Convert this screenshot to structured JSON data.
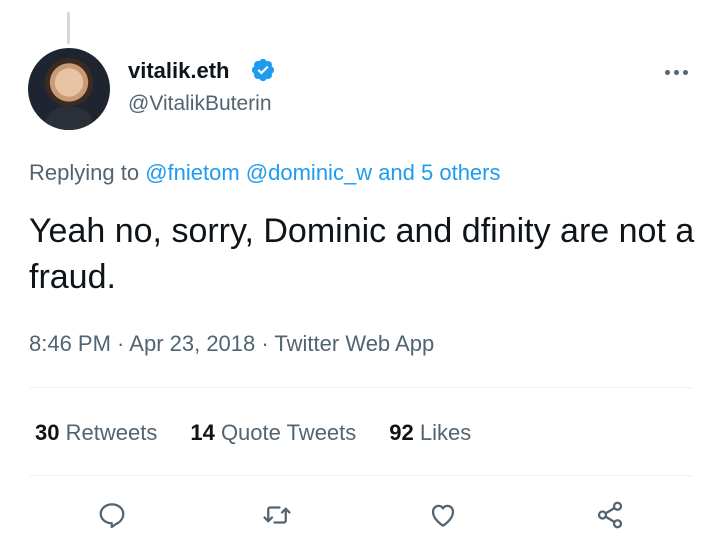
{
  "author": {
    "display_name": "vitalik.eth",
    "handle": "@VitalikButerin",
    "verified_icon": "verified-badge-icon"
  },
  "more_icon": "more-horizontal-icon",
  "replying": {
    "prefix": "Replying to ",
    "users": [
      "@fnietom",
      "@dominic_w"
    ],
    "others": "and 5 others"
  },
  "tweet": {
    "text": "Yeah no, sorry, Dominic and dfinity are not a fraud."
  },
  "meta": {
    "time": "8:46 PM",
    "date": "Apr 23, 2018",
    "source": "Twitter Web App",
    "separator": " · "
  },
  "stats": {
    "retweets_count": "30",
    "retweets_label": "Retweets",
    "quotes_count": "14",
    "quotes_label": "Quote Tweets",
    "likes_count": "92",
    "likes_label": "Likes"
  },
  "actions": [
    "reply-icon",
    "retweet-icon",
    "like-icon",
    "share-icon"
  ],
  "colors": {
    "accent": "#1d9bf0",
    "secondary_text": "#536471",
    "primary_text": "#0f1419"
  }
}
